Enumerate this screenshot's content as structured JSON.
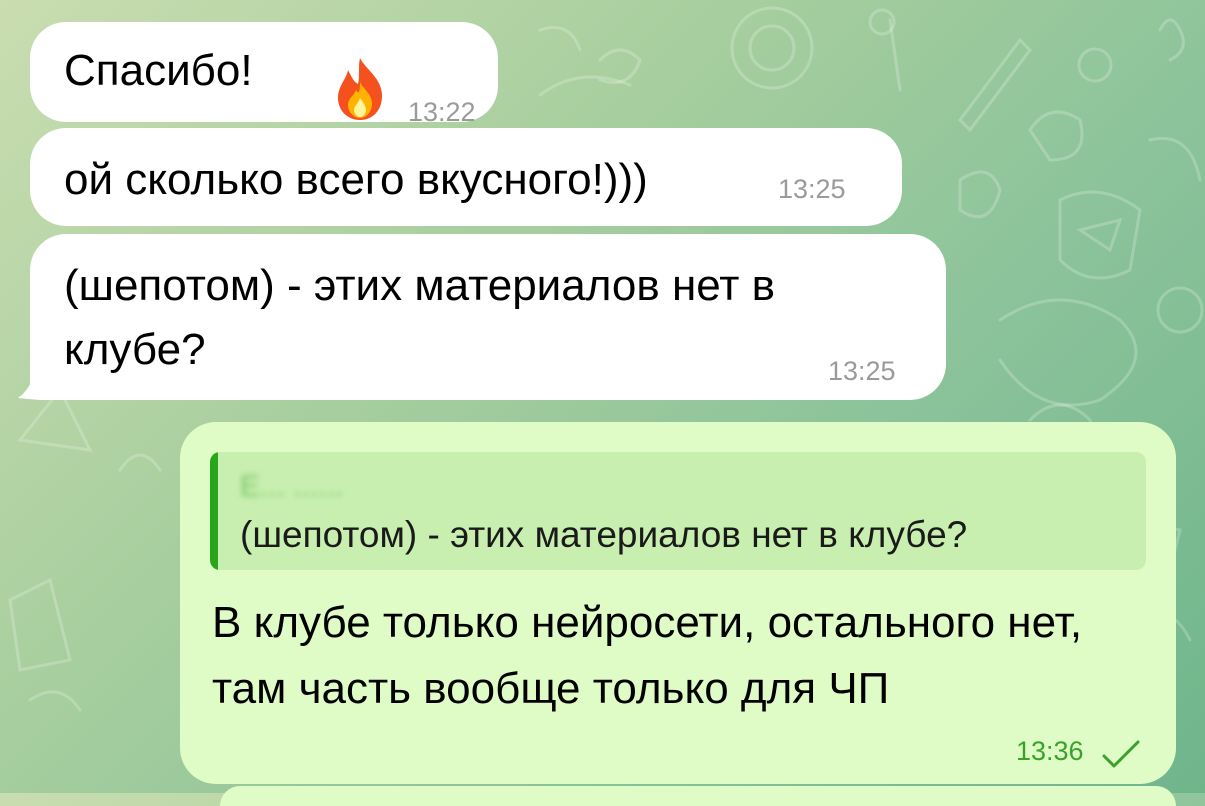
{
  "chat": {
    "messages": [
      {
        "text": "Спасибо!",
        "emoji": "fire",
        "time": "13:22",
        "direction": "incoming"
      },
      {
        "text": "ой сколько всего вкусного!)))",
        "time": "13:25",
        "direction": "incoming"
      },
      {
        "text": "(шепотом) - этих материалов нет в клубе?",
        "time": "13:25",
        "direction": "incoming"
      },
      {
        "reply": {
          "sender": "Е... ......",
          "quote": "(шепотом) - этих материалов нет в клубе?"
        },
        "text": "В клубе только нейросети, остального нет, там часть вообще только для ЧП",
        "time": "13:36",
        "status": "read-check",
        "direction": "outgoing"
      }
    ]
  },
  "colors": {
    "incoming_bubble": "#ffffff",
    "outgoing_bubble": "#e0fcc6",
    "reply_bar": "#27a51b",
    "outgoing_time": "#3aa22b"
  }
}
